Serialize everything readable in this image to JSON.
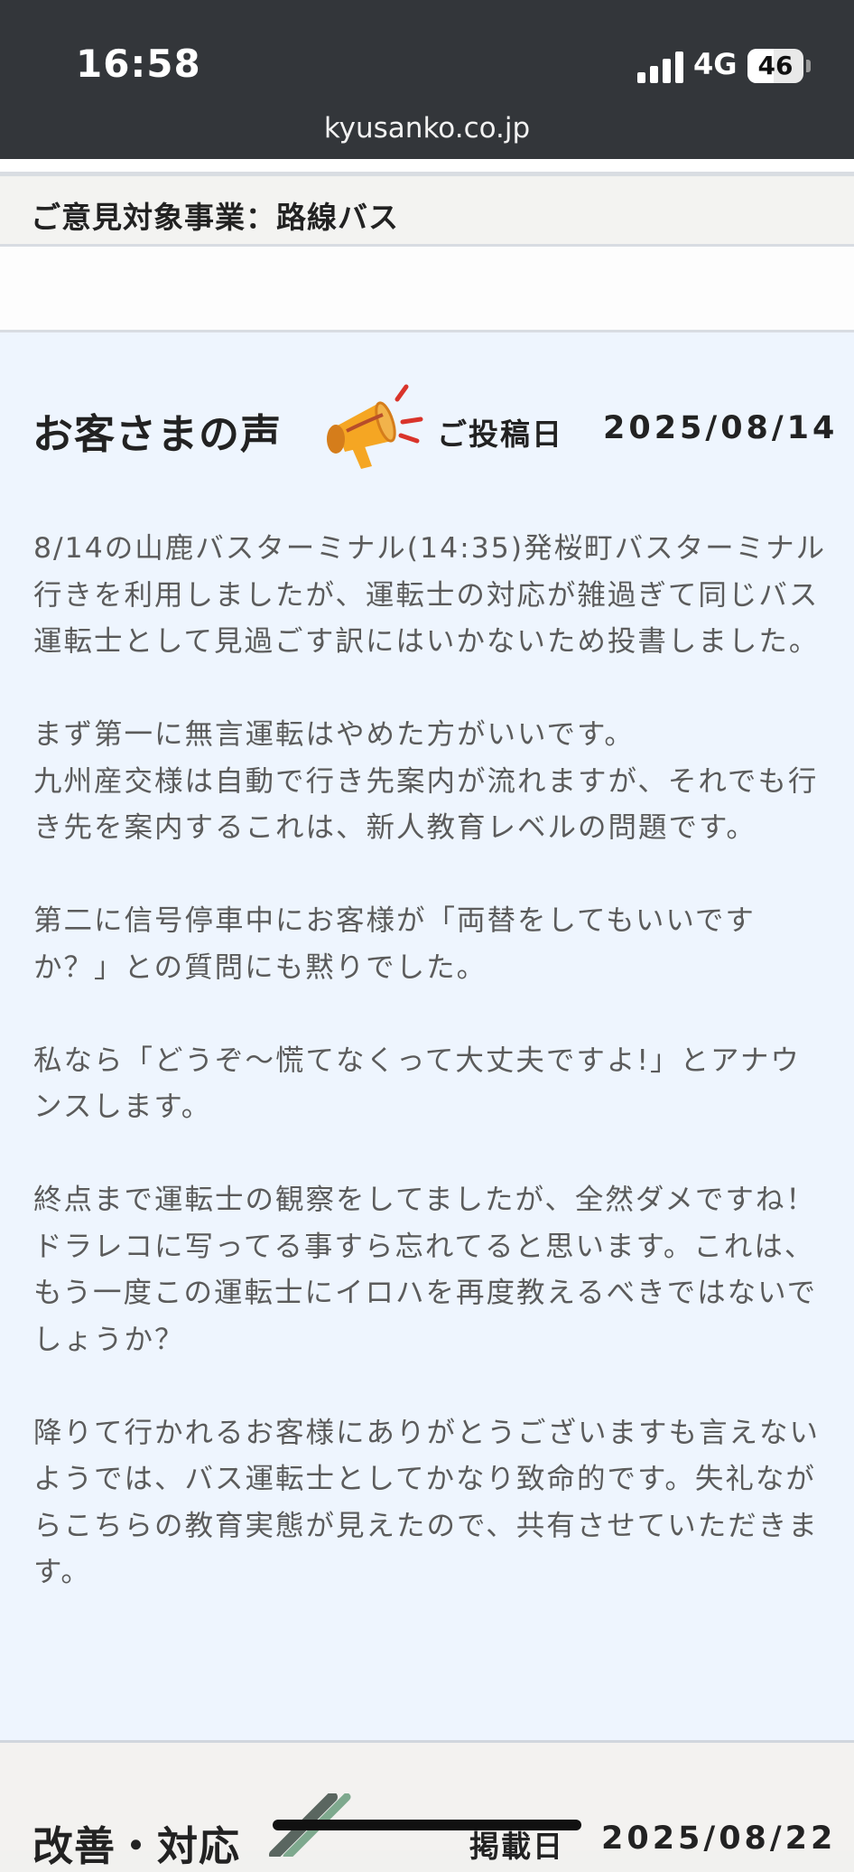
{
  "status_bar": {
    "time": "16:58",
    "network": "4G",
    "battery": "46",
    "battery_level": 0.46,
    "signal_icon": "cellular-signal-icon",
    "battery_icon": "battery-icon"
  },
  "browser": {
    "url": "kyusanko.co.jp"
  },
  "target": {
    "text": "ご意見対象事業：路線バス"
  },
  "voice": {
    "heading": "お客さまの声",
    "icon": "megaphone-icon",
    "posted_label": "ご投稿日",
    "posted_date": "2025/08/14",
    "body": "8/14の山鹿バスターミナル(14:35)発桜町バスターミナル行きを利用しましたが、運転士の対応が雑過ぎて同じバス運転士として見過ごす訳にはいかないため投書しました。\n\nまず第一に無言運転はやめた方がいいです。\n九州産交様は自動で行き先案内が流れますが、それでも行き先を案内するこれは、新人教育レベルの問題です。\n\n第二に信号停車中にお客様が「両替をしてもいいですか？」との質問にも黙りでした。\n\n私なら「どうぞ〜慌てなくって大丈夫ですよ!」とアナウンスします。\n\n終点まで運転士の観察をしてましたが、全然ダメですね！　ドラレコに写ってる事すら忘れてると思います。これは、もう一度この運転士にイロハを再度教えるべきではないでしょうか？\n\n降りて行かれるお客様にありがとうございますも言えないようでは、バス運転士としてかなり致命的です。失礼ながらこちらの教育実態が見えたので、共有させていただきます。"
  },
  "response": {
    "heading": "改善・対応",
    "icon": "pencil-icon",
    "published_label": "掲載日",
    "published_date": "2025/08/22"
  },
  "colors": {
    "status_bar_bg": "#33363a",
    "voice_card_bg": "#eef5fe",
    "megaphone": "#f5a623",
    "megaphone_accent": "#d9342b",
    "body_text": "#5b5b5b"
  }
}
